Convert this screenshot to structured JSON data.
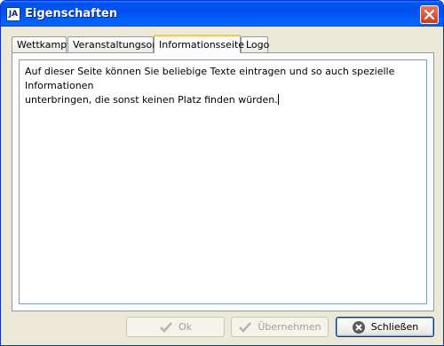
{
  "window": {
    "title": "Eigenschaften",
    "icon": "app-icon",
    "icon_text": "JA"
  },
  "tabs": [
    {
      "label": "Wettkampf",
      "active": false
    },
    {
      "label": "Veranstaltungsort",
      "active": false
    },
    {
      "label": "Informationsseite",
      "active": true
    },
    {
      "label": "Logo",
      "active": false
    }
  ],
  "info_text": "Auf dieser Seite können Sie beliebige Texte eintragen und so auch spezielle Informationen\nunterbringen, die sonst keinen Platz finden würden.",
  "buttons": {
    "ok": {
      "label": "Ok",
      "enabled": false
    },
    "apply": {
      "label": "Übernehmen",
      "enabled": false
    },
    "close": {
      "label": "Schließen",
      "enabled": true
    }
  },
  "colors": {
    "titlebar": "#0054E3",
    "face": "#ECE9D8",
    "close_button": "#D1492A",
    "active_tab_accent": "#FFC73C"
  }
}
